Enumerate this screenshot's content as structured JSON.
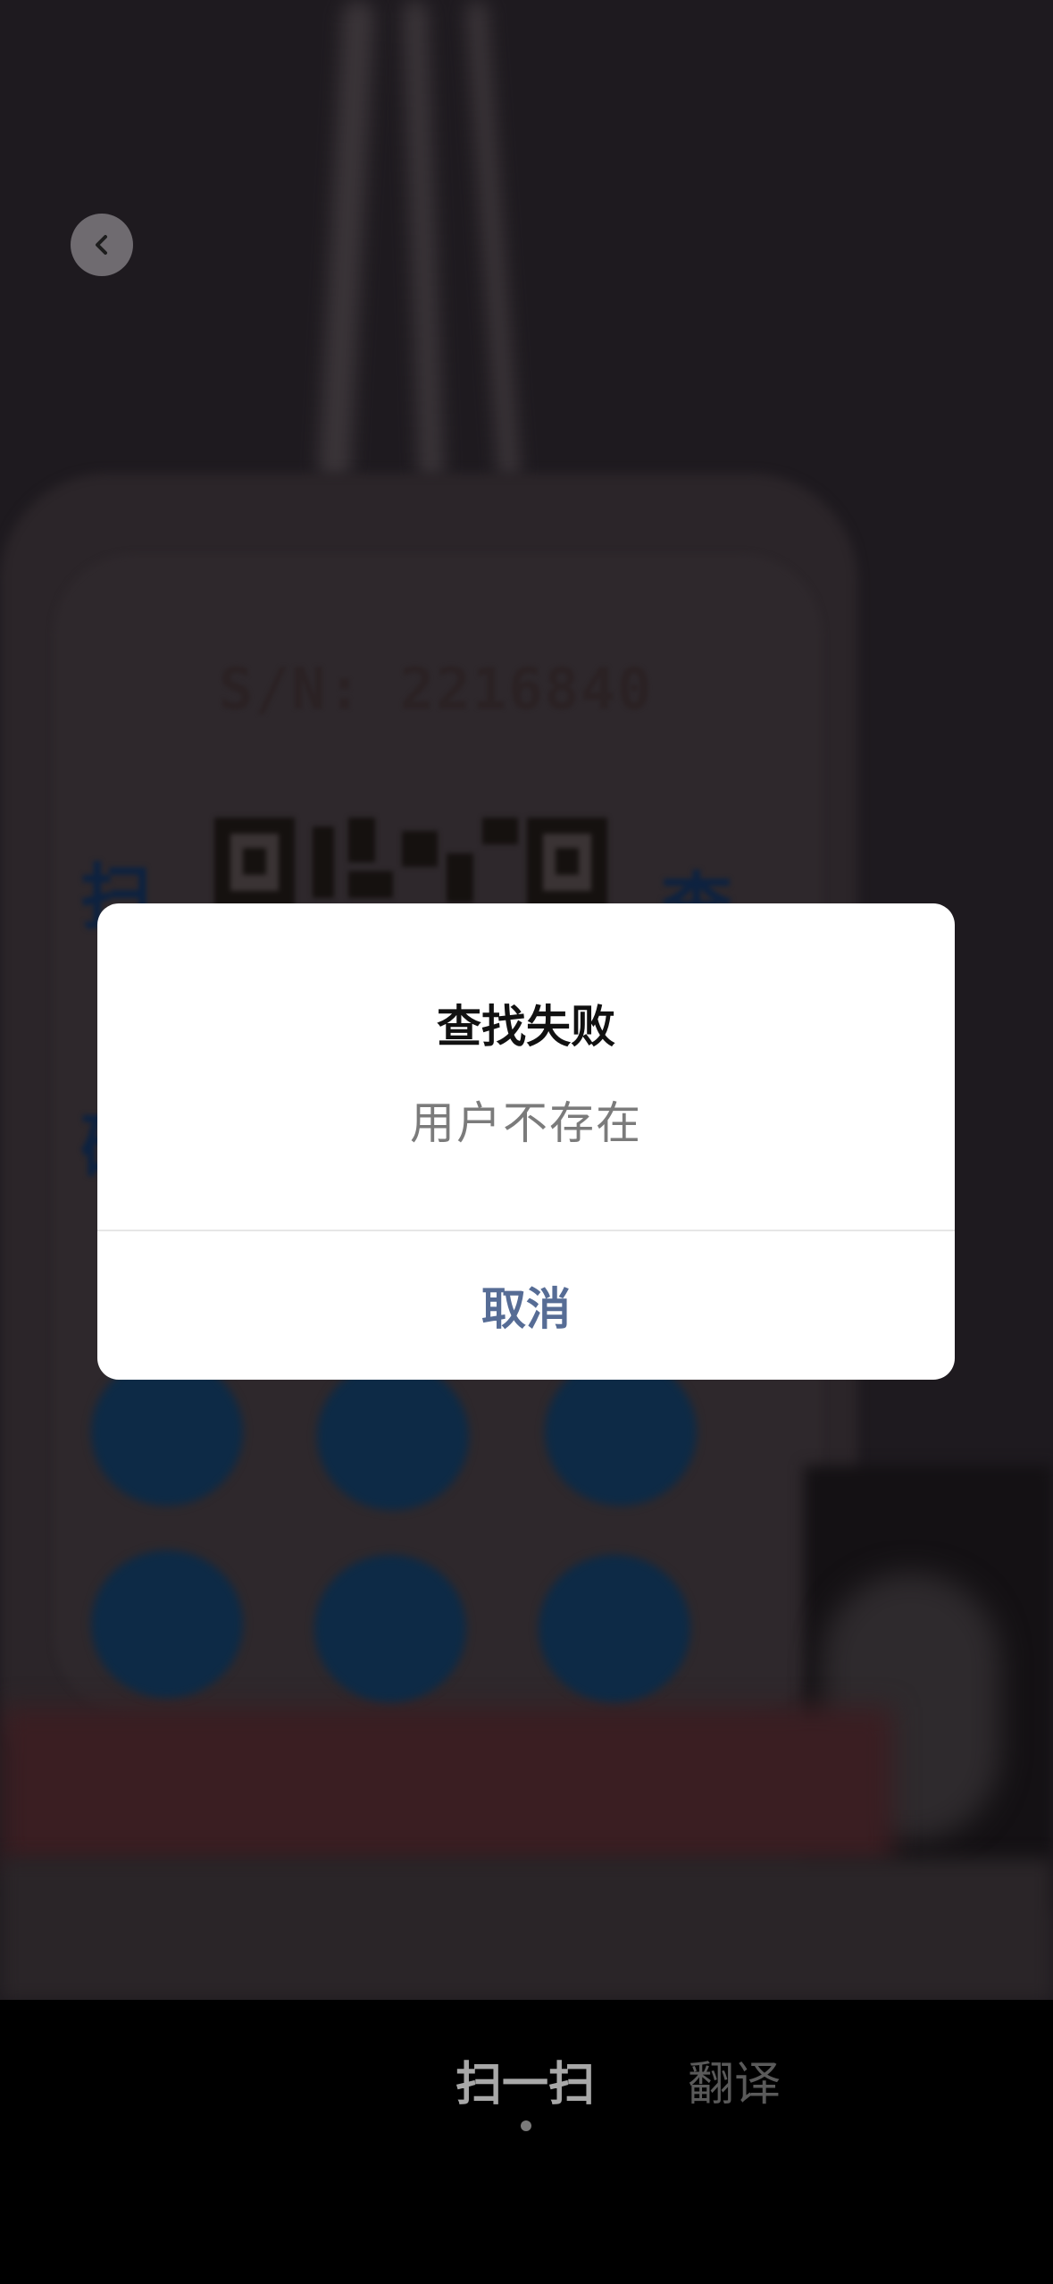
{
  "camera": {
    "serial_text": "S/N: 2216840",
    "marks": [
      "扫",
      "查",
      "硬"
    ]
  },
  "nav": {
    "back_icon": "chevron-left-icon"
  },
  "alert": {
    "title": "查找失败",
    "message": "用户不存在",
    "cancel_label": "取消"
  },
  "mode_bar": {
    "tabs": [
      {
        "label": "扫一扫",
        "active": true
      },
      {
        "label": "翻译",
        "active": false
      }
    ]
  },
  "colors": {
    "cancel_text": "#566c95",
    "title_text": "#111111",
    "message_text": "#7b7b7b",
    "active_tab": "#a8a8a8",
    "inactive_tab": "#5a5a5a"
  }
}
